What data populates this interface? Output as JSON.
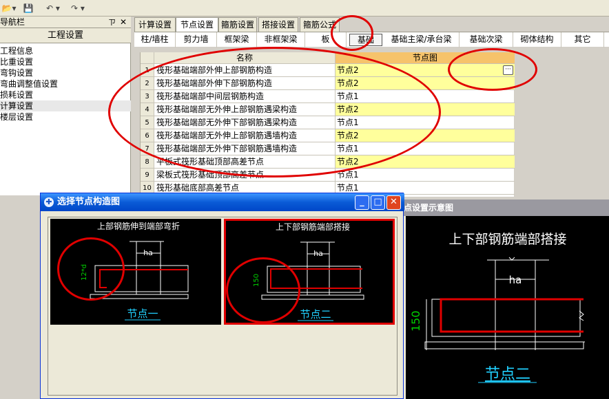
{
  "toolbar": {
    "buttons": [
      "📂▾",
      "💾",
      "↶ ▾",
      "↷ ▾"
    ]
  },
  "nav": {
    "caption": "导航栏",
    "pin": "ㄗ",
    "close": "✕",
    "header": "工程设置",
    "items": [
      "工程信息",
      "比重设置",
      "弯钩设置",
      "弯曲调整值设置",
      "损耗设置",
      "计算设置",
      "楼层设置"
    ]
  },
  "tabs_main": [
    "计算设置",
    "节点设置",
    "箍筋设置",
    "搭接设置",
    "箍筋公式"
  ],
  "tabs_sub": [
    "柱/墙柱",
    "剪力墙",
    "框架梁",
    "非框架梁",
    "板",
    "基础",
    "基础主梁/承台梁",
    "基础次梁",
    "砌体结构",
    "其它"
  ],
  "grid": {
    "col_name": "名称",
    "col_node": "节点图",
    "rows": [
      {
        "num": "1",
        "name": "筏形基础端部外伸上部钢筋构造",
        "node": "节点2"
      },
      {
        "num": "2",
        "name": "筏形基础端部外伸下部钢筋构造",
        "node": "节点2"
      },
      {
        "num": "3",
        "name": "筏形基础端部中间层钢筋构造",
        "node": "节点1"
      },
      {
        "num": "4",
        "name": "筏形基础端部无外伸上部钢筋遇梁构造",
        "node": "节点2"
      },
      {
        "num": "5",
        "name": "筏形基础端部无外伸下部钢筋遇梁构造",
        "node": "节点1"
      },
      {
        "num": "6",
        "name": "筏形基础端部无外伸上部钢筋遇墙构造",
        "node": "节点2"
      },
      {
        "num": "7",
        "name": "筏形基础端部无外伸下部钢筋遇墙构造",
        "node": "节点1"
      },
      {
        "num": "8",
        "name": "平板式筏形基础顶部高差节点",
        "node": "节点2"
      },
      {
        "num": "9",
        "name": "梁板式筏形基础顶部高差节点",
        "node": "节点1"
      },
      {
        "num": "10",
        "name": "筏形基础底部高差节点",
        "node": "节点1"
      }
    ],
    "ellipsis": "···"
  },
  "dialog": {
    "title": "选择节点构造图",
    "min": "_",
    "max": "□",
    "close": "✕",
    "thumb1": {
      "caption": "上部钢筋伸到端部弯折",
      "dim_ha": "ha",
      "dim_side": "12*d",
      "label": "节点一"
    },
    "thumb2": {
      "caption": "上下部钢筋端部搭接",
      "dim_ha": "ha",
      "dim_side": "150",
      "label": "节点二"
    }
  },
  "preview": {
    "title": "点设置示意图",
    "caption": "上下部钢筋端部搭接",
    "dim_ha": "ha",
    "dim_side": "150",
    "label": "节点二"
  },
  "colors": {
    "node_header": "#f6c36b",
    "row_highlight": "#ffff9c",
    "annotation": "#e00000",
    "rebar": "#e00000",
    "dim_green": "#00d000",
    "label_cyan": "#20d0ff"
  }
}
